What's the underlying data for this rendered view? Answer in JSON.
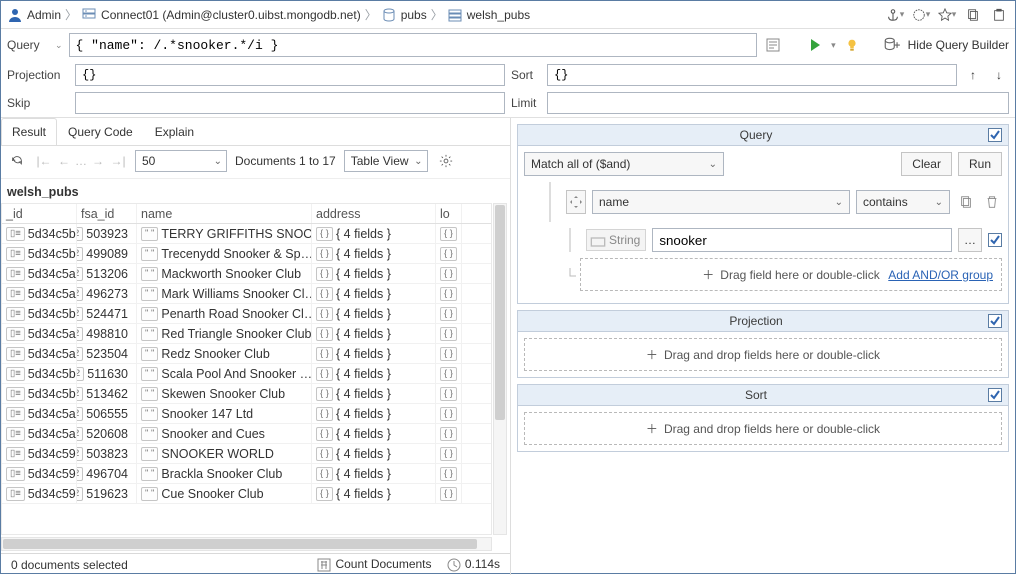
{
  "breadcrumb": {
    "user": "Admin",
    "connection": "Connect01 (Admin@cluster0.uibst.mongodb.net)",
    "database": "pubs",
    "collection": "welsh_pubs"
  },
  "query_bar": {
    "label": "Query",
    "value": "{ \"name\": /.*snooker.*/i }",
    "hide_builder_label": "Hide Query Builder"
  },
  "projection": {
    "label": "Projection",
    "value": "{}"
  },
  "sort": {
    "label": "Sort",
    "value": "{}"
  },
  "skip": {
    "label": "Skip",
    "value": ""
  },
  "limit": {
    "label": "Limit",
    "value": ""
  },
  "tabs": {
    "result": "Result",
    "query_code": "Query Code",
    "explain": "Explain"
  },
  "pager": {
    "page_size": "50",
    "status": "Documents 1 to 17",
    "view": "Table View"
  },
  "table": {
    "title": "welsh_pubs",
    "columns": {
      "id": "_id",
      "fsa": "fsa_id",
      "name": "name",
      "address": "address",
      "lo": "lo"
    },
    "addr_template": "{ 4 fields }",
    "rows": [
      {
        "id": "5d34c5b…",
        "fsa": "503923",
        "name": "TERRY GRIFFITHS SNOOK…"
      },
      {
        "id": "5d34c5b…",
        "fsa": "499089",
        "name": "Trecenydd Snooker & Sp…"
      },
      {
        "id": "5d34c5a…",
        "fsa": "513206",
        "name": "Mackworth Snooker Club"
      },
      {
        "id": "5d34c5a…",
        "fsa": "496273",
        "name": "Mark Williams Snooker Cl…"
      },
      {
        "id": "5d34c5b…",
        "fsa": "524471",
        "name": "Penarth Road Snooker Cl…"
      },
      {
        "id": "5d34c5a…",
        "fsa": "498810",
        "name": "Red Triangle Snooker Club"
      },
      {
        "id": "5d34c5a…",
        "fsa": "523504",
        "name": "Redz Snooker Club"
      },
      {
        "id": "5d34c5b…",
        "fsa": "511630",
        "name": "Scala Pool And Snooker …"
      },
      {
        "id": "5d34c5b…",
        "fsa": "513462",
        "name": "Skewen Snooker Club"
      },
      {
        "id": "5d34c5a…",
        "fsa": "506555",
        "name": "Snooker 147 Ltd"
      },
      {
        "id": "5d34c5a…",
        "fsa": "520608",
        "name": "Snooker and Cues"
      },
      {
        "id": "5d34c59…",
        "fsa": "503823",
        "name": "SNOOKER WORLD"
      },
      {
        "id": "5d34c59…",
        "fsa": "496704",
        "name": "Brackla Snooker Club"
      },
      {
        "id": "5d34c59…",
        "fsa": "519623",
        "name": "Cue Snooker Club"
      }
    ]
  },
  "status": {
    "selected": "0 documents selected",
    "count_docs": "Count Documents",
    "timing": "0.114s"
  },
  "builder": {
    "query": {
      "title": "Query",
      "match_mode": "Match all of ($and)",
      "clear": "Clear",
      "run": "Run",
      "field": "name",
      "op": "contains",
      "type": "String",
      "value": "snooker",
      "drop_hint": "Drag field here or double-click",
      "add_group": "Add AND/OR group"
    },
    "projection": {
      "title": "Projection",
      "drop_hint": "Drag and drop fields here or double-click"
    },
    "sort": {
      "title": "Sort",
      "drop_hint": "Drag and drop fields here or double-click"
    }
  }
}
